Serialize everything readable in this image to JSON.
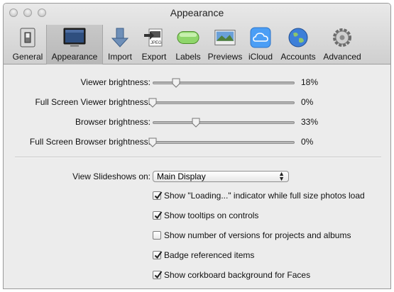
{
  "window": {
    "title": "Appearance"
  },
  "toolbar": {
    "items": [
      {
        "label": "General",
        "icon": "general-switch-icon"
      },
      {
        "label": "Appearance",
        "icon": "appearance-monitor-icon",
        "selected": true
      },
      {
        "label": "Import",
        "icon": "import-arrow-icon"
      },
      {
        "label": "Export",
        "icon": "export-jpeg-icon"
      },
      {
        "label": "Labels",
        "icon": "labels-icon"
      },
      {
        "label": "Previews",
        "icon": "previews-photo-icon"
      },
      {
        "label": "iCloud",
        "icon": "icloud-icon"
      },
      {
        "label": "Accounts",
        "icon": "accounts-globe-icon"
      },
      {
        "label": "Advanced",
        "icon": "advanced-gear-icon"
      }
    ]
  },
  "sliders": [
    {
      "label": "Viewer brightness:",
      "value_text": "18%",
      "value": 0.18
    },
    {
      "label": "Full Screen Viewer brightness:",
      "value_text": "0%",
      "value": 0.0
    },
    {
      "label": "Browser brightness:",
      "value_text": "33%",
      "value": 0.33
    },
    {
      "label": "Full Screen Browser brightness:",
      "value_text": "0%",
      "value": 0.0
    }
  ],
  "slideshow": {
    "label": "View Slideshows on:",
    "selected": "Main Display"
  },
  "checkboxes": [
    {
      "label": "Show \"Loading...\" indicator while full size photos load",
      "checked": true
    },
    {
      "label": "Show tooltips on controls",
      "checked": true
    },
    {
      "label": "Show number of versions for projects and albums",
      "checked": false
    },
    {
      "label": "Badge referenced items",
      "checked": true
    },
    {
      "label": "Show corkboard background for Faces",
      "checked": true
    }
  ]
}
